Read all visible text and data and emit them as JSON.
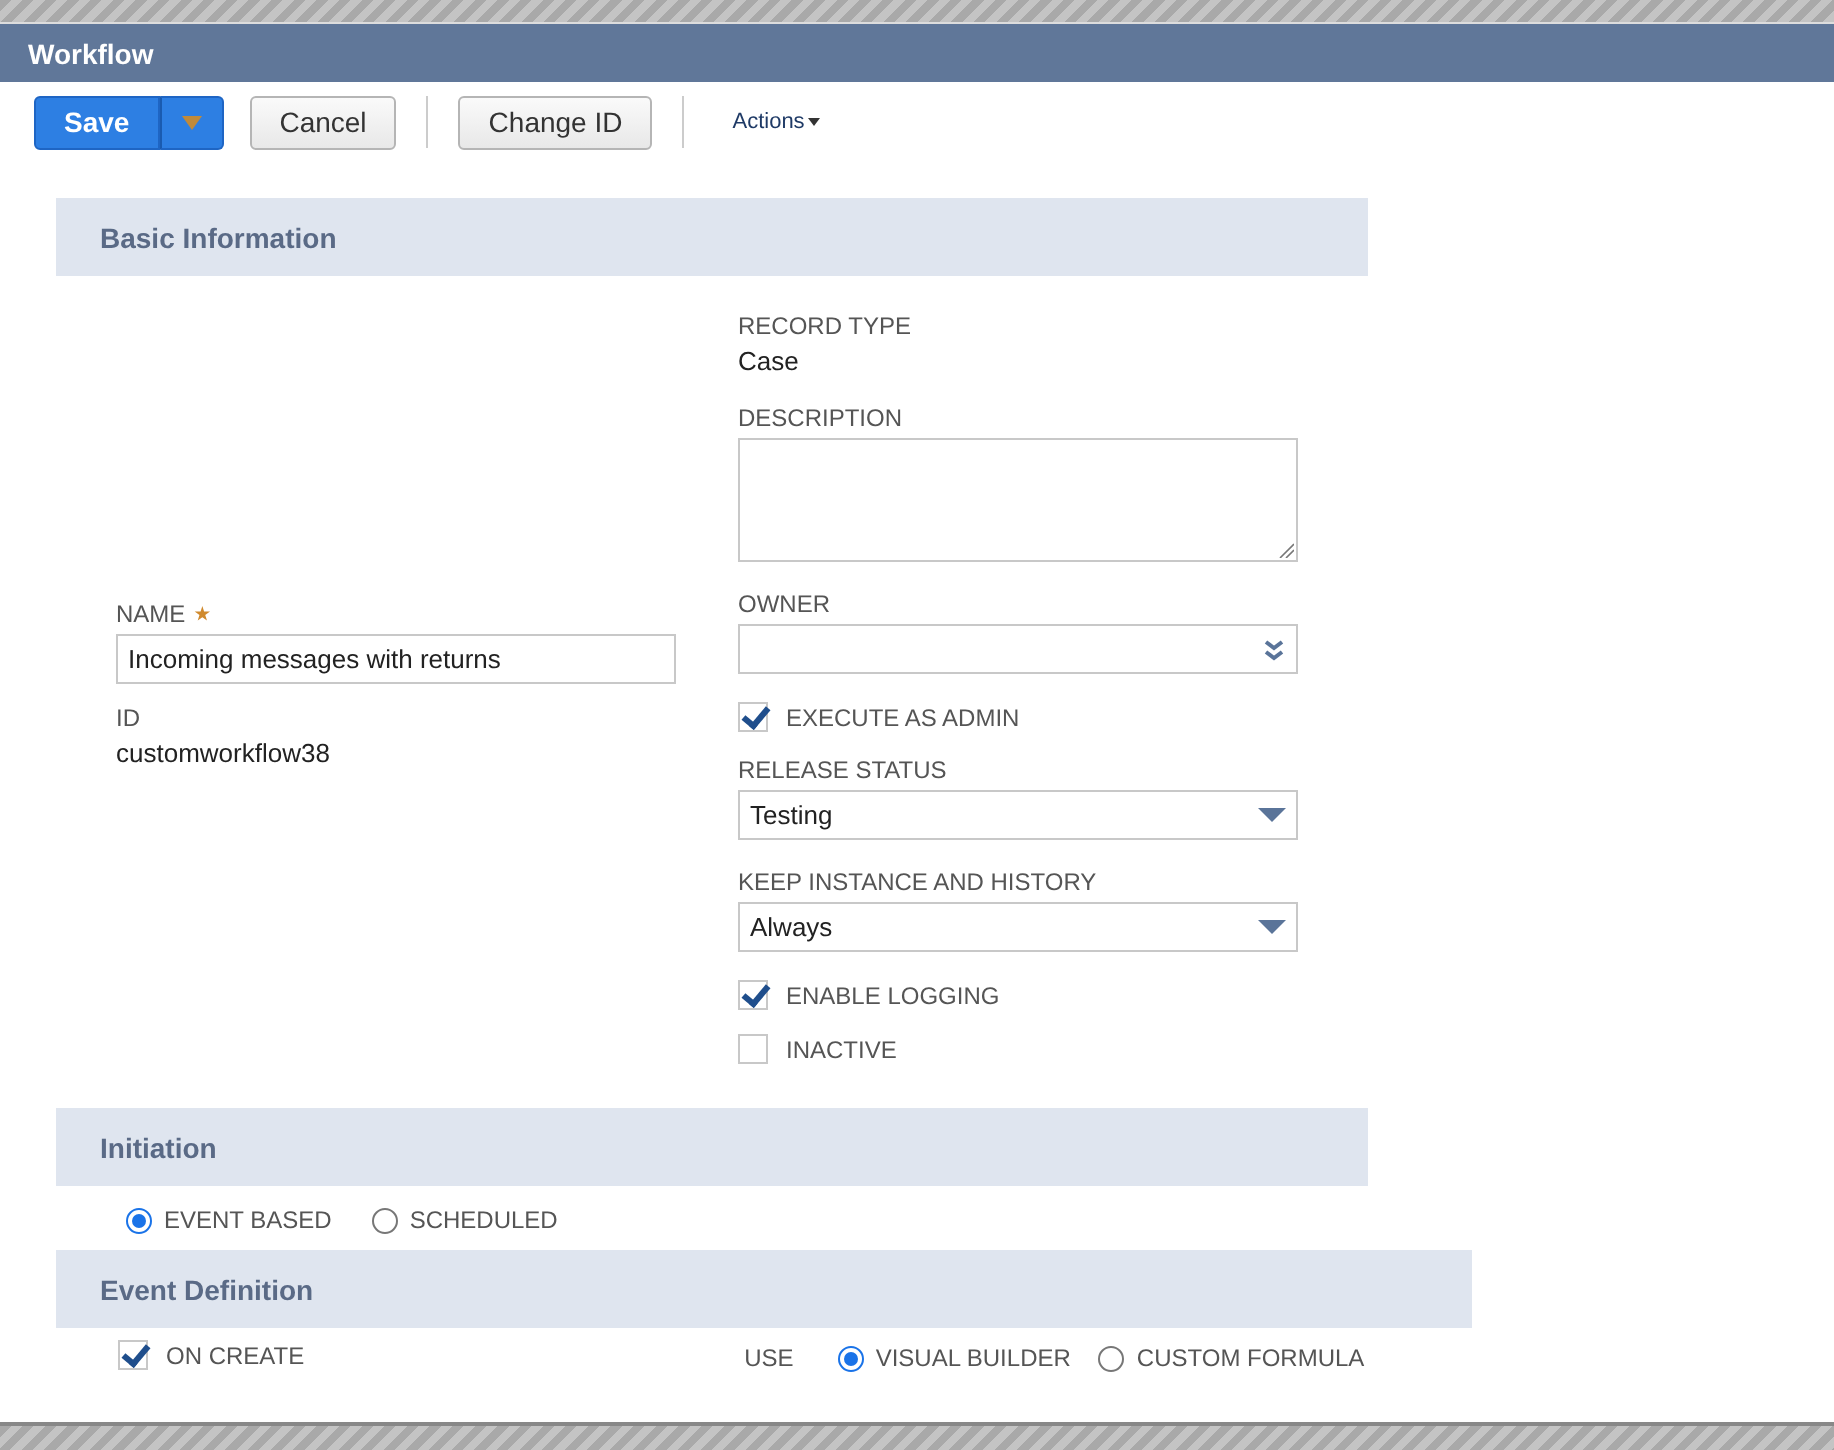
{
  "window": {
    "title": "Workflow"
  },
  "toolbar": {
    "buttons": [
      {
        "label": "Save",
        "kind": "primary"
      },
      {
        "label": "Cancel",
        "kind": "plain"
      },
      {
        "label": "Change ID",
        "kind": "plain"
      }
    ],
    "menu": "Actions"
  },
  "basic": {
    "title": "Basic Information",
    "left": [
      {
        "kind": "input",
        "label": "NAME",
        "required": true,
        "value": "Incoming messages with returns"
      },
      {
        "kind": "static",
        "label": "ID",
        "value": "customworkflow38"
      }
    ],
    "right": [
      {
        "kind": "static",
        "label": "RECORD TYPE",
        "value": "Case"
      },
      {
        "kind": "textarea",
        "label": "DESCRIPTION"
      },
      {
        "kind": "lookup",
        "label": "OWNER"
      },
      {
        "kind": "checkbox",
        "label": "EXECUTE AS ADMIN",
        "checked": true
      },
      {
        "kind": "select",
        "label": "RELEASE STATUS",
        "value": "Testing"
      },
      {
        "kind": "select",
        "label": "KEEP INSTANCE AND HISTORY",
        "value": "Always"
      },
      {
        "kind": "checkbox",
        "label": "ENABLE LOGGING",
        "checked": true
      },
      {
        "kind": "checkbox",
        "label": "INACTIVE",
        "checked": false
      }
    ]
  },
  "initiation": {
    "title": "Initiation",
    "options": [
      {
        "label": "EVENT BASED",
        "selected": true
      },
      {
        "label": "SCHEDULED",
        "selected": false
      }
    ]
  },
  "event_definition": {
    "title": "Event Definition",
    "on_create": {
      "label": "ON CREATE",
      "checked": true
    },
    "use_label": "USE",
    "use_options": [
      {
        "label": "VISUAL BUILDER",
        "selected": true
      },
      {
        "label": "CUSTOM FORMULA",
        "selected": false
      }
    ]
  }
}
